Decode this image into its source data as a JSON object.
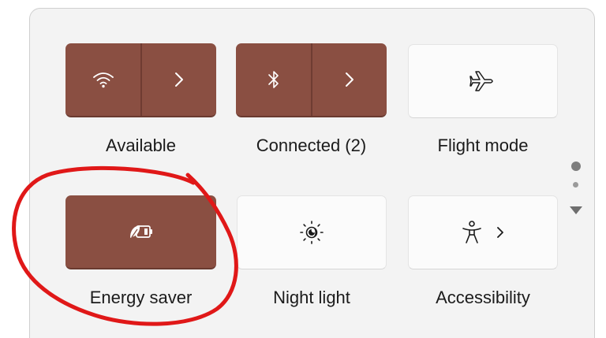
{
  "quick_settings": {
    "tiles": [
      {
        "id": "wifi",
        "label": "Available",
        "state": "on",
        "icon": "wifi-icon",
        "has_expand": true
      },
      {
        "id": "bluetooth",
        "label": "Connected (2)",
        "state": "on",
        "icon": "bluetooth-icon",
        "has_expand": true
      },
      {
        "id": "flight_mode",
        "label": "Flight mode",
        "state": "off",
        "icon": "airplane-icon",
        "has_expand": false
      },
      {
        "id": "energy_saver",
        "label": "Energy saver",
        "state": "on",
        "icon": "energy-saver-icon",
        "has_expand": false
      },
      {
        "id": "night_light",
        "label": "Night light",
        "state": "off",
        "icon": "night-light-icon",
        "has_expand": false
      },
      {
        "id": "accessibility",
        "label": "Accessibility",
        "state": "off",
        "icon": "accessibility-icon",
        "has_expand": true
      }
    ],
    "pager": {
      "pages": 2,
      "current_page": 1
    }
  },
  "annotation": {
    "shape": "hand-drawn-circle",
    "target": "energy_saver",
    "color": "#e01818"
  },
  "colors": {
    "accent": "#8a4f42",
    "tile_off": "#fbfbfb",
    "panel": "#f3f3f3",
    "text": "#1b1b1b"
  }
}
